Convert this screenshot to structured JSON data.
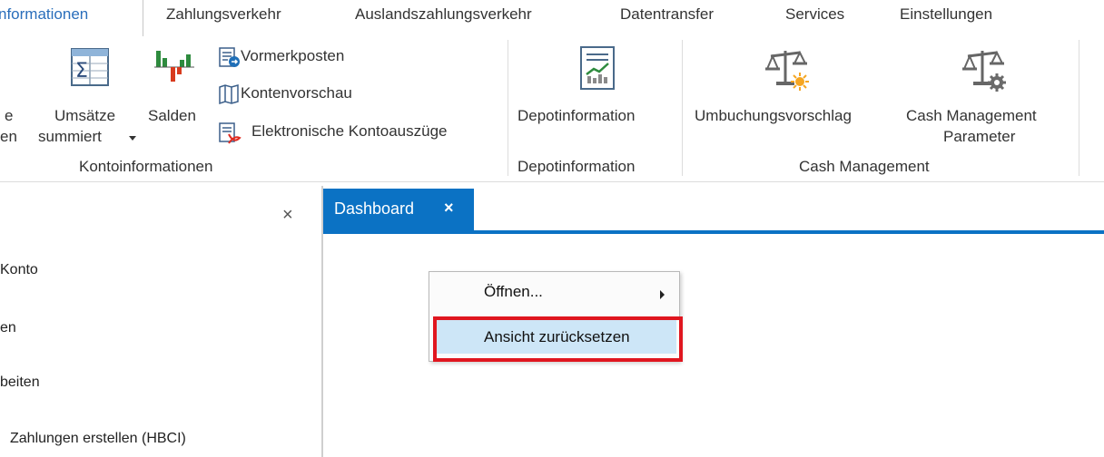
{
  "tabs": [
    {
      "label": "nformationen",
      "active": true
    },
    {
      "label": "Zahlungsverkehr"
    },
    {
      "label": "Auslandszahlungsverkehr"
    },
    {
      "label": "Datentransfer"
    },
    {
      "label": "Services"
    },
    {
      "label": "Einstellungen"
    }
  ],
  "ribbon": {
    "cut_label_top": "e",
    "cut_label_bottom": "en",
    "umsaetze": {
      "line1": "Umsätze",
      "line2": "summiert"
    },
    "salden": "Salden",
    "vormerkposten": "Vormerkposten",
    "kontenvorschau": "Kontenvorschau",
    "kontoauszuege": "Elektronische Kontoauszüge",
    "depotinformation": "Depotinformation",
    "umbuchung": "Umbuchungsvorschlag",
    "cash_param": {
      "line1": "Cash Management",
      "line2": "Parameter"
    },
    "groups": {
      "konto": "Kontoinformationen",
      "depot": "Depotinformation",
      "cash": "Cash Management"
    }
  },
  "left_pane": {
    "close": "×",
    "items": [
      "Konto",
      "en",
      "beiten",
      "Zahlungen erstellen (HBCI)"
    ]
  },
  "document": {
    "tab_label": "Dashboard",
    "tab_close": "×"
  },
  "context_menu": {
    "items": [
      "Öffnen...",
      "Ansicht zurücksetzen"
    ]
  },
  "colors": {
    "accent_blue": "#0b72c4",
    "highlight_red": "#e0161f",
    "hover_blue": "#cde6f7"
  }
}
